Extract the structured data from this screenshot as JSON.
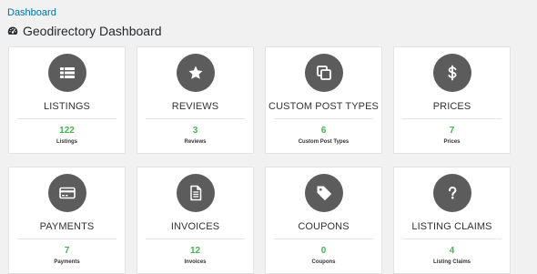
{
  "breadcrumb": "Dashboard",
  "page_title": "Geodirectory Dashboard",
  "accent_count_color": "#46b450",
  "icon_circle_color": "#5c5c5c",
  "cards": [
    {
      "title": "LISTINGS",
      "count": "122",
      "sub": "Listings",
      "icon": "list-icon"
    },
    {
      "title": "REVIEWS",
      "count": "3",
      "sub": "Reviews",
      "icon": "star-icon"
    },
    {
      "title": "CUSTOM POST TYPES",
      "count": "6",
      "sub": "Custom Post Types",
      "icon": "clone-icon"
    },
    {
      "title": "PRICES",
      "count": "7",
      "sub": "Prices",
      "icon": "dollar-icon"
    },
    {
      "title": "PAYMENTS",
      "count": "7",
      "sub": "Payments",
      "icon": "credit-card-icon"
    },
    {
      "title": "INVOICES",
      "count": "12",
      "sub": "Invoices",
      "icon": "file-text-icon"
    },
    {
      "title": "COUPONS",
      "count": "0",
      "sub": "Coupons",
      "icon": "tag-icon"
    },
    {
      "title": "LISTING CLAIMS",
      "count": "4",
      "sub": "Listing Claims",
      "icon": "question-icon"
    }
  ]
}
